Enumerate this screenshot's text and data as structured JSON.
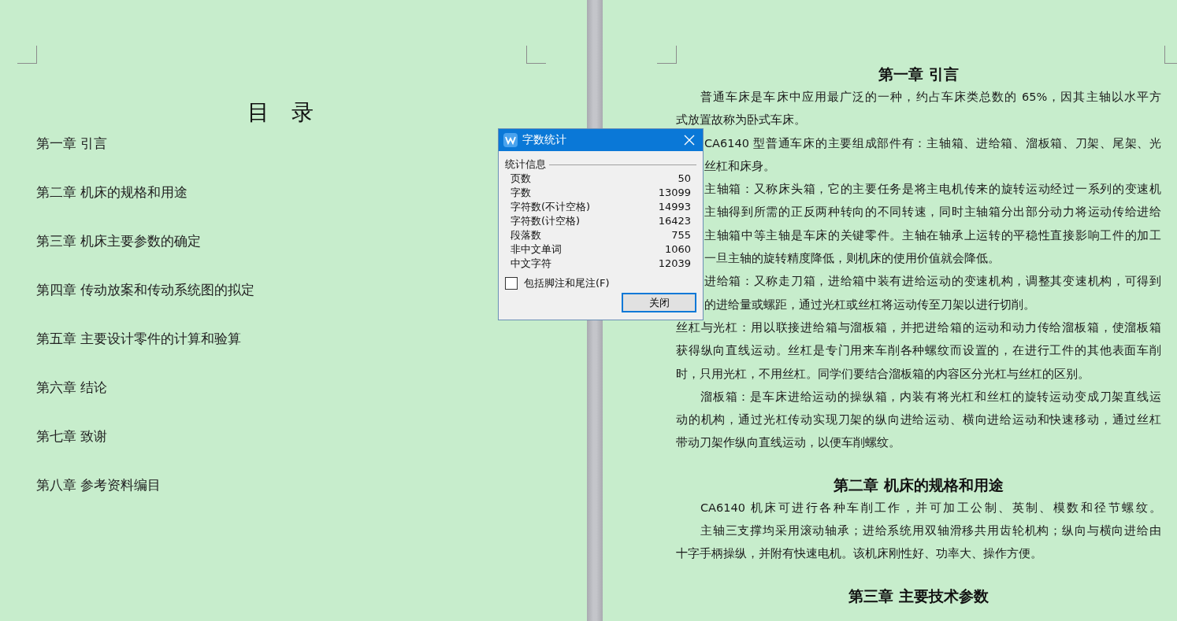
{
  "left_page": {
    "title": "目　录",
    "toc": [
      "第一章  引言",
      "第二章  机床的规格和用途",
      "第三章  机床主要参数的确定",
      "第四章  传动放案和传动系统图的拟定",
      "第五章  主要设计零件的计算和验算",
      "第六章  结论",
      "第七章  致谢",
      "第八章  参考资料编目"
    ]
  },
  "right_page": {
    "blocks": [
      {
        "kind": "heading",
        "text": "第一章  引言"
      },
      {
        "kind": "first",
        "text": "普通车床是车床中应用最广泛的一种，约占车床类总数的 65%，因其主轴以水平方"
      },
      {
        "kind": "last",
        "text": "式放置故称为卧式车床。"
      },
      {
        "kind": "full",
        "text": "CA6140 型普通车床的主要组成部件有：主轴箱、进给箱、溜板箱、刀架、尾架、光",
        "covered": true
      },
      {
        "kind": "last",
        "text": "丝杠和床身。",
        "covered": true
      },
      {
        "kind": "full",
        "text": "主轴箱：又称床头箱，它的主要任务是将主电机传来的旋转运动经过一系列的变速机",
        "covered": true
      },
      {
        "kind": "full",
        "text": "主轴得到所需的正反两种转向的不同转速，同时主轴箱分出部分动力将运动传给进给",
        "covered": true
      },
      {
        "kind": "full",
        "text": "主轴箱中等主轴是车床的关键零件。主轴在轴承上运转的平稳性直接影响工件的加工",
        "covered": true
      },
      {
        "kind": "last",
        "text": "一旦主轴的旋转精度降低，则机床的使用价值就会降低。",
        "covered": true
      },
      {
        "kind": "full",
        "text": "进给箱：又称走刀箱，进给箱中装有进给运动的变速机构，调整其变速机构，可得到",
        "covered": true
      },
      {
        "kind": "last",
        "text": "的进给量或螺距，通过光杠或丝杠将运动传至刀架以进行切削。",
        "covered": true
      },
      {
        "kind": "full",
        "text": "丝杠与光杠：用以联接进给箱与溜板箱，并把进给箱的运动和动力传给溜板箱，使溜板箱"
      },
      {
        "kind": "full",
        "text": "获得纵向直线运动。丝杠是专门用来车削各种螺纹而设置的，在进行工件的其他表面车削"
      },
      {
        "kind": "last",
        "text": "时，只用光杠，不用丝杠。同学们要结合溜板箱的内容区分光杠与丝杠的区别。"
      },
      {
        "kind": "first",
        "text": "溜板箱：是车床进给运动的操纵箱，内装有将光杠和丝杠的旋转运动变成刀架直线运"
      },
      {
        "kind": "full",
        "text": "动的机构，通过光杠传动实现刀架的纵向进给运动、横向进给运动和快速移动，通过丝杠"
      },
      {
        "kind": "last",
        "text": "带动刀架作纵向直线运动，以便车削螺纹。"
      },
      {
        "kind": "heading",
        "text": "第二章  机床的规格和用途"
      },
      {
        "kind": "first",
        "text": "CA6140 机床可进行各种车削工作，并可加工公制、英制、模数和径节螺纹。"
      },
      {
        "kind": "first",
        "text": "主轴三支撑均采用滚动轴承；进给系统用双轴滑移共用齿轮机构；纵向与横向进给由"
      },
      {
        "kind": "last",
        "text": "十字手柄操纵，并附有快速电机。该机床刚性好、功率大、操作方便。"
      },
      {
        "kind": "heading",
        "text": "第三章  主要技术参数"
      }
    ]
  },
  "dialog": {
    "title": "字数统计",
    "section": "统计信息",
    "stats": [
      {
        "label": "页数",
        "value": "50"
      },
      {
        "label": "字数",
        "value": "13099"
      },
      {
        "label": "字符数(不计空格)",
        "value": "14993"
      },
      {
        "label": "字符数(计空格)",
        "value": "16423"
      },
      {
        "label": "段落数",
        "value": "755"
      },
      {
        "label": "非中文单词",
        "value": "1060"
      },
      {
        "label": "中文字符",
        "value": "12039"
      }
    ],
    "checkbox": {
      "label": "包括脚注和尾注(F)",
      "checked": false
    },
    "button": "关闭"
  }
}
